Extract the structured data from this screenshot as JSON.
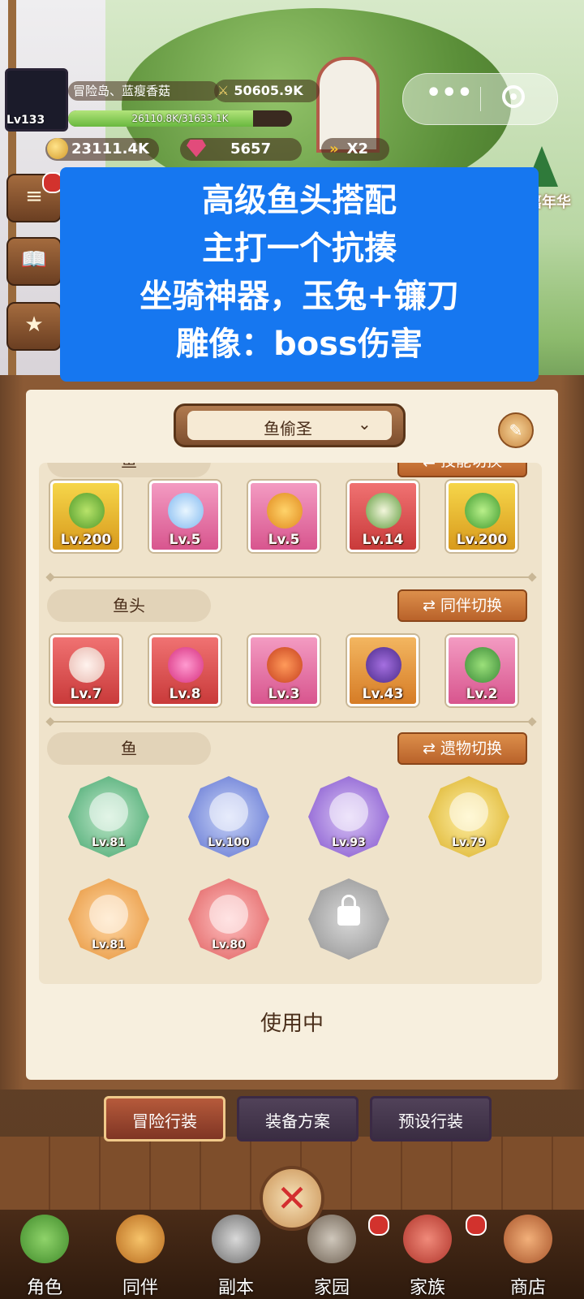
{
  "hud": {
    "player_level": "Lv133",
    "location": "冒险岛、蓝瘦香菇",
    "power": "50605.9K",
    "hp_text": "26110.8K/31633.1K",
    "hp_fraction": 0.825,
    "gold": "23111.4K",
    "gems": "5657",
    "speed": "X2",
    "event_label": "嘉年华"
  },
  "caption": {
    "lines": [
      "高级鱼头搭配",
      "主打一个抗揍",
      "坐骑神器，玉兔+镰刀",
      "雕像：boss伤害"
    ]
  },
  "loadout": {
    "name": "鱼偷圣"
  },
  "sections": {
    "skills": {
      "title": "鱼",
      "button": "技能切换",
      "levels": [
        "Lv.200",
        "Lv.5",
        "Lv.5",
        "Lv.14",
        "Lv.200"
      ]
    },
    "partners": {
      "title": "鱼头",
      "button": "同伴切换",
      "levels": [
        "Lv.7",
        "Lv.8",
        "Lv.3",
        "Lv.43",
        "Lv.2"
      ]
    },
    "relics": {
      "title": "鱼",
      "button": "遗物切换",
      "levels": [
        "Lv.81",
        "Lv.100",
        "Lv.93",
        "Lv.79",
        "Lv.81",
        "Lv.80"
      ]
    }
  },
  "status": "使用中",
  "tabs": [
    "冒险行装",
    "装备方案",
    "预设行装"
  ],
  "nav": [
    "角色",
    "同伴",
    "副本",
    "家园",
    "家族",
    "商店"
  ],
  "colors": {
    "caption_bg": "#1677f0",
    "panel_bg": "#f7efde",
    "active_tab": "#b65a3b"
  }
}
